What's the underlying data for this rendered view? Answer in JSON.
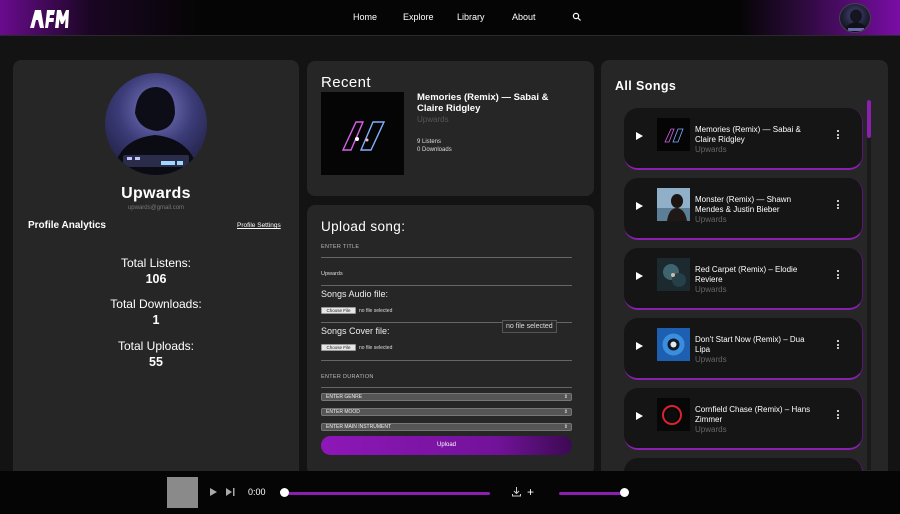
{
  "nav": {
    "items": [
      "Home",
      "Explore",
      "Library",
      "About"
    ]
  },
  "profile": {
    "name": "Upwards",
    "email": "upwards@gmail.com",
    "analytics_title": "Profile Analytics",
    "settings_link": "Profile Settings",
    "stats": [
      {
        "label": "Total Listens:",
        "value": "106"
      },
      {
        "label": "Total Downloads:",
        "value": "1"
      },
      {
        "label": "Total Uploads:",
        "value": "55"
      }
    ]
  },
  "recent": {
    "title": "Recent",
    "song_title": "Memories (Remix) — Sabai & Claire Ridgley",
    "artist": "Upwards",
    "listens": "9 Listens",
    "downloads": "0 Downloads"
  },
  "upload": {
    "title": "Upload song:",
    "title_label": "ENTER TITLE",
    "title_value": "Upwards",
    "audio_label": "Songs Audio file:",
    "cover_label": "Songs Cover file:",
    "choose_file": "Choose File",
    "no_file": "no file selected",
    "tooltip": "no file selected",
    "duration_label": "ENTER DURATION",
    "genre_select": "ENTER GENRE",
    "mood_select": "ENTER MOOD",
    "instrument_select": "ENTER MAIN INSTRUMENT",
    "button": "Upload"
  },
  "all_songs": {
    "title": "All Songs",
    "songs": [
      {
        "title": "Memories (Remix) — Sabai & Claire Ridgley",
        "artist": "Upwards"
      },
      {
        "title": "Monster (Remix) — Shawn Mendes & Justin Bieber",
        "artist": "Upwards"
      },
      {
        "title": "Red Carpet (Remix) –  Elodie Reviere",
        "artist": "Upwards"
      },
      {
        "title": "Don't Start Now (Remix) – Dua Lipa",
        "artist": "Upwards"
      },
      {
        "title": "Cornfield Chase (Remix) – Hans Zimmer",
        "artist": "Upwards"
      }
    ]
  },
  "player": {
    "time": "0:00",
    "progress": 0,
    "volume": 1.0
  },
  "colors": {
    "accent": "#8b1fb0",
    "panel": "#262626",
    "background": "#131313"
  }
}
